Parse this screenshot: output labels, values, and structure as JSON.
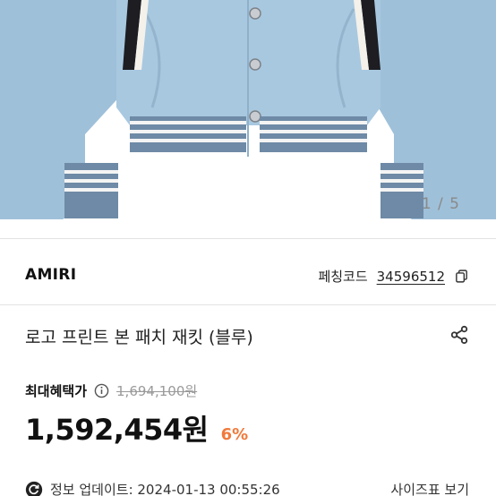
{
  "gallery": {
    "counter": "1 / 5",
    "image": "light-blue varsity bomber jacket with striped ribbed cuffs and hem"
  },
  "brand": {
    "name": "AMIRI",
    "code_label": "페칭코드",
    "code_value": "34596512"
  },
  "product": {
    "title": "로고 프린트 본 패치 재킷 (블루)"
  },
  "pricing": {
    "max_benefit_label": "최대혜택가",
    "original_price": "1,694,100원",
    "price": "1,592,454원",
    "discount": "6%"
  },
  "info": {
    "update_text": "정보 업데이트: 2024-01-13 00:55:26",
    "size_guide": "사이즈표 보기"
  },
  "colors": {
    "jacket": "#a8c8e0",
    "discount": "#f07a3c"
  }
}
